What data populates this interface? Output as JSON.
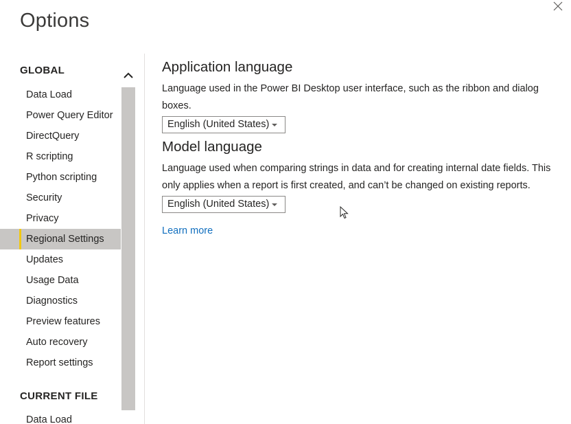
{
  "window": {
    "title": "Options",
    "close_icon": "close-icon"
  },
  "sidebar": {
    "global_heading": "GLOBAL",
    "global_items": [
      {
        "label": "Data Load",
        "selected": false
      },
      {
        "label": "Power Query Editor",
        "selected": false
      },
      {
        "label": "DirectQuery",
        "selected": false
      },
      {
        "label": "R scripting",
        "selected": false
      },
      {
        "label": "Python scripting",
        "selected": false
      },
      {
        "label": "Security",
        "selected": false
      },
      {
        "label": "Privacy",
        "selected": false
      },
      {
        "label": "Regional Settings",
        "selected": true
      },
      {
        "label": "Updates",
        "selected": false
      },
      {
        "label": "Usage Data",
        "selected": false
      },
      {
        "label": "Diagnostics",
        "selected": false
      },
      {
        "label": "Preview features",
        "selected": false
      },
      {
        "label": "Auto recovery",
        "selected": false
      },
      {
        "label": "Report settings",
        "selected": false
      }
    ],
    "current_file_heading": "CURRENT FILE",
    "current_file_items": [
      {
        "label": "Data Load"
      }
    ],
    "scroll_up_icon": "chevron-up-icon"
  },
  "main": {
    "application_language": {
      "title": "Application language",
      "description": "Language used in the Power BI Desktop user interface, such as the ribbon and dialog boxes.",
      "selected_value": "English (United States)"
    },
    "model_language": {
      "title": "Model language",
      "description": "Language used when comparing strings in data and for creating internal date fields. This only applies when a report is first created, and can’t be changed on existing reports.",
      "selected_value": "English (United States)"
    },
    "learn_more_label": "Learn more"
  },
  "colors": {
    "selected_bg": "#c8c6c4",
    "selected_accent": "#f2c811",
    "link": "#106ebe"
  }
}
